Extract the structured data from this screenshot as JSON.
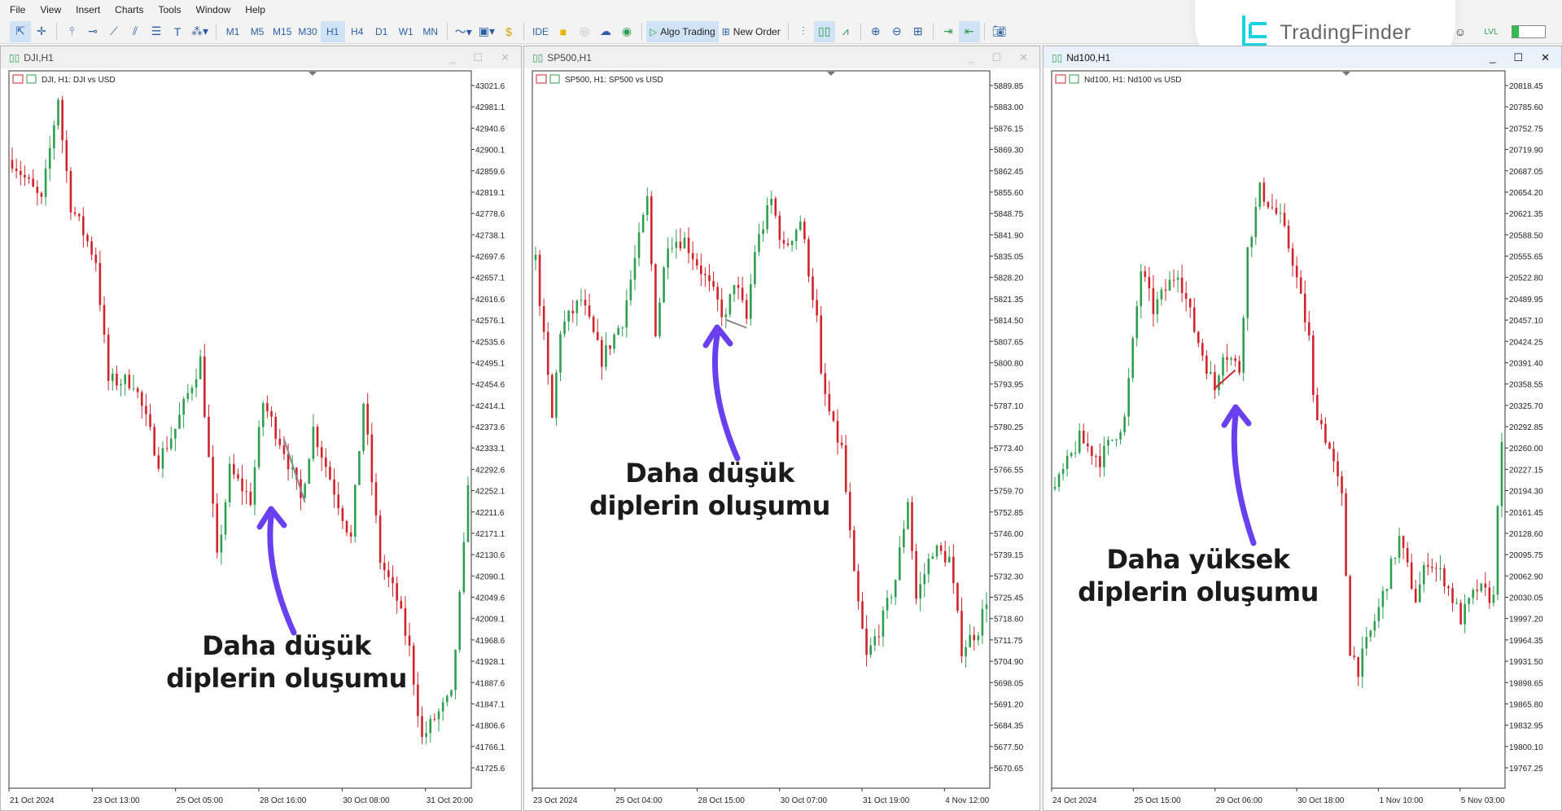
{
  "menu": [
    "File",
    "View",
    "Insert",
    "Charts",
    "Tools",
    "Window",
    "Help"
  ],
  "toolbar": {
    "tools": [
      "cursor-icon",
      "crosshair-icon",
      "vertical-line-icon",
      "horizontal-line-icon",
      "trendline-icon",
      "channel-icon",
      "fibonacci-icon",
      "text-icon",
      "shapes-icon"
    ],
    "timeframes": [
      "M1",
      "M5",
      "M15",
      "M30",
      "H1",
      "H4",
      "D1",
      "W1",
      "MN"
    ],
    "active_timeframe": "H1",
    "ide_label": "IDE",
    "algo_label": "Algo Trading",
    "new_order_label": "New Order"
  },
  "logo": {
    "text": "TradingFinder",
    "color": "#19d3e0"
  },
  "colors": {
    "bull": "#2e9e4f",
    "bear": "#d0232b",
    "annotation": "#6a3ff0"
  },
  "charts": [
    {
      "title": "DJI,H1",
      "legend": "DJI, H1:  DJI vs USD",
      "ticks": [
        "43021.6",
        "42981.1",
        "42940.6",
        "42900.1",
        "42859.6",
        "42819.1",
        "42778.6",
        "42738.1",
        "42697.6",
        "42657.1",
        "42616.6",
        "42576.1",
        "42535.6",
        "42495.1",
        "42454.6",
        "42414.1",
        "42373.6",
        "42333.1",
        "42292.6",
        "42252.1",
        "42211.6",
        "42171.1",
        "42130.6",
        "42090.1",
        "42049.6",
        "42009.1",
        "41968.6",
        "41928.1",
        "41887.6",
        "41847.1",
        "41806.6",
        "41766.1",
        "41725.6"
      ],
      "dates": [
        "21 Oct 2024",
        "23 Oct 13:00",
        "25 Oct 05:00",
        "28 Oct 16:00",
        "30 Oct 08:00",
        "31 Oct 20:00"
      ],
      "annotation": [
        "Daha düşük",
        "diplerin oluşumu"
      ],
      "path": [
        [
          0,
          42880
        ],
        [
          7,
          42800
        ],
        [
          11,
          43000
        ],
        [
          12,
          42920
        ],
        [
          14,
          42795
        ],
        [
          20,
          42690
        ],
        [
          23,
          42460
        ],
        [
          29,
          42460
        ],
        [
          35,
          42310
        ],
        [
          39,
          42370
        ],
        [
          45,
          42500
        ],
        [
          49,
          42120
        ],
        [
          52,
          42290
        ],
        [
          57,
          42235
        ],
        [
          60,
          42420
        ],
        [
          65,
          42330
        ],
        [
          69,
          42235
        ],
        [
          72,
          42370
        ],
        [
          81,
          42160
        ],
        [
          84,
          42420
        ],
        [
          88,
          42120
        ],
        [
          92,
          42045
        ],
        [
          95,
          41950
        ],
        [
          98,
          41780
        ],
        [
          101,
          41820
        ],
        [
          105,
          41860
        ],
        [
          108,
          42140
        ],
        [
          109,
          42275
        ]
      ]
    },
    {
      "title": "SP500,H1",
      "legend": "SP500, H1:  SP500 vs USD",
      "ticks": [
        "5889.85",
        "5883.00",
        "5876.15",
        "5869.30",
        "5862.45",
        "5855.60",
        "5848.75",
        "5841.90",
        "5835.05",
        "5828.20",
        "5821.35",
        "5814.50",
        "5807.65",
        "5800.80",
        "5793.95",
        "5787.10",
        "5780.25",
        "5773.40",
        "5766.55",
        "5759.70",
        "5752.85",
        "5746.00",
        "5739.15",
        "5732.30",
        "5725.45",
        "5718.60",
        "5711.75",
        "5704.90",
        "5698.05",
        "5691.20",
        "5684.35",
        "5677.50",
        "5670.65"
      ],
      "dates": [
        "23 Oct 2024",
        "25 Oct 04:00",
        "28 Oct 15:00",
        "30 Oct 07:00",
        "31 Oct 19:00",
        "4 Nov 12:00"
      ],
      "annotation": [
        "Daha düşük",
        "diplerin oluşumu"
      ],
      "path": [
        [
          0,
          5833.8
        ],
        [
          4,
          5782.6
        ],
        [
          6,
          5811.4
        ],
        [
          11,
          5821
        ],
        [
          16,
          5801.8
        ],
        [
          21,
          5814.6
        ],
        [
          27,
          5853
        ],
        [
          29,
          5811.4
        ],
        [
          32,
          5840.2
        ],
        [
          36,
          5840.2
        ],
        [
          40,
          5830.6
        ],
        [
          46,
          5814.6
        ],
        [
          48,
          5827.4
        ],
        [
          51,
          5814.6
        ],
        [
          53,
          5837
        ],
        [
          57,
          5853
        ],
        [
          60,
          5837
        ],
        [
          64,
          5846.6
        ],
        [
          68,
          5814.6
        ],
        [
          69,
          5795.4
        ],
        [
          72,
          5779.4
        ],
        [
          74,
          5773
        ],
        [
          77,
          5731.4
        ],
        [
          80,
          5705.8
        ],
        [
          84,
          5718.6
        ],
        [
          87,
          5731.4
        ],
        [
          90,
          5757
        ],
        [
          92,
          5725
        ],
        [
          96,
          5741
        ],
        [
          100,
          5737.8
        ],
        [
          103,
          5709
        ],
        [
          107,
          5715.4
        ],
        [
          109,
          5725
        ]
      ]
    },
    {
      "title": "Nd100,H1",
      "legend": "Nd100, H1:  Nd100 vs USD",
      "ticks": [
        "20818.45",
        "20785.60",
        "20752.75",
        "20719.90",
        "20687.05",
        "20654.20",
        "20621.35",
        "20588.50",
        "20555.65",
        "20522.80",
        "20489.95",
        "20457.10",
        "20424.25",
        "20391.40",
        "20358.55",
        "20325.70",
        "20292.85",
        "20260.00",
        "20227.15",
        "20194.30",
        "20161.45",
        "20128.60",
        "20095.75",
        "20062.90",
        "20030.05",
        "19997.20",
        "19964.35",
        "19931.50",
        "19898.65",
        "19865.80",
        "19832.95",
        "19800.10",
        "19767.25"
      ],
      "dates": [
        "24 Oct 2024",
        "25 Oct 15:00",
        "29 Oct 06:00",
        "30 Oct 18:00",
        "1 Nov 10:00",
        "5 Nov 03:00"
      ],
      "annotation": [
        "Daha yüksek",
        "diplerin oluşumu"
      ],
      "path": [
        [
          0,
          20196.9
        ],
        [
          6,
          20273.7
        ],
        [
          11,
          20243
        ],
        [
          17,
          20304.4
        ],
        [
          21,
          20534.6
        ],
        [
          24,
          20473.2
        ],
        [
          30,
          20534.6
        ],
        [
          34,
          20442.5
        ],
        [
          39,
          20350.4
        ],
        [
          41,
          20411.8
        ],
        [
          45,
          20381.1
        ],
        [
          47,
          20565.2
        ],
        [
          50,
          20657.3
        ],
        [
          55,
          20611.3
        ],
        [
          58,
          20549.9
        ],
        [
          62,
          20427.1
        ],
        [
          63,
          20334.7
        ],
        [
          67,
          20258
        ],
        [
          70,
          20181.3
        ],
        [
          72,
          19951.1
        ],
        [
          74,
          19920.4
        ],
        [
          79,
          20012.5
        ],
        [
          84,
          20119.9
        ],
        [
          88,
          20027.8
        ],
        [
          91,
          20089.2
        ],
        [
          95,
          20058.5
        ],
        [
          99,
          19997.1
        ],
        [
          103,
          20043.2
        ],
        [
          107,
          20027.8
        ],
        [
          108,
          20181.3
        ],
        [
          109,
          20258
        ]
      ]
    }
  ]
}
